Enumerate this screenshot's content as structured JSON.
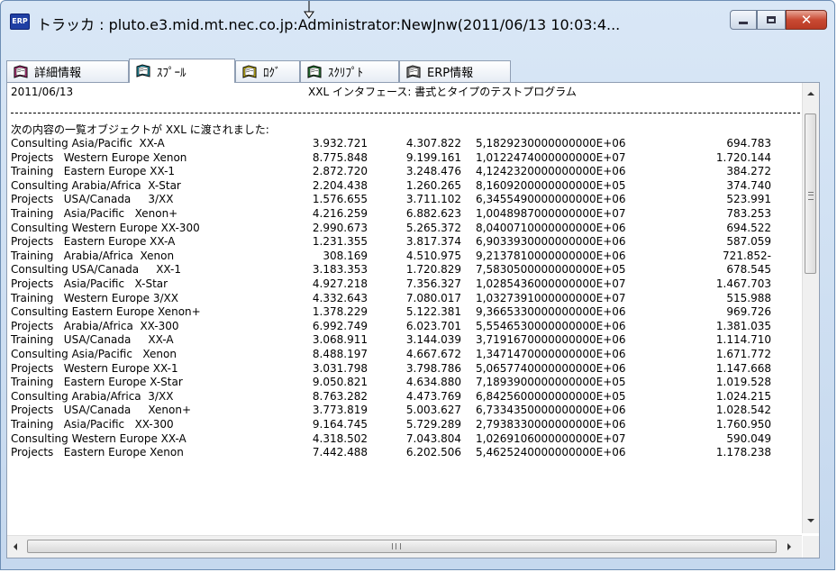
{
  "window": {
    "app_icon_label": "ERP",
    "title": "トラッカ : pluto.e3.mid.mt.nec.co.jp:Administrator:NewJnw(2011/06/13 10:03:4...",
    "colors": {
      "frame": "#c5d8ee",
      "close_button": "#c94a33",
      "tab_active": "#ffffff"
    }
  },
  "tabs": [
    {
      "label": "詳細情報",
      "icon": "book-icon",
      "active": false
    },
    {
      "label": "ｽﾌﾟｰﾙ",
      "icon": "book-icon",
      "active": true
    },
    {
      "label": "ﾛｸﾞ",
      "icon": "book-icon",
      "active": false
    },
    {
      "label": "ｽｸﾘﾌﾟﾄ",
      "icon": "book-icon",
      "active": false
    },
    {
      "label": "ERP情報",
      "icon": "book-icon",
      "active": false
    }
  ],
  "spool": {
    "date": "2011/06/13",
    "header": "XXL インタフェース: 書式とタイプのテストプログラム",
    "intro": "次の内容の一覧オブジェクトが XXL に渡されました:",
    "rows": [
      [
        "Consulting Asia/Pacific  XX-A",
        "3.932.721",
        "4.307.822",
        "5,1829230000000000E+06",
        "694.783"
      ],
      [
        "Projects   Western Europe Xenon",
        "8.775.848",
        "9.199.161",
        "1,0122474000000000E+07",
        "1.720.144"
      ],
      [
        "Training   Eastern Europe XX-1",
        "2.872.720",
        "3.248.476",
        "4,1242320000000000E+06",
        "384.272"
      ],
      [
        "Consulting Arabia/Africa  X-Star",
        "2.204.438",
        "1.260.265",
        "8,1609200000000000E+05",
        "374.740"
      ],
      [
        "Projects   USA/Canada     3/XX",
        "1.576.655",
        "3.711.102",
        "6,3455490000000000E+06",
        "523.991"
      ],
      [
        "Training   Asia/Pacific   Xenon+",
        "4.216.259",
        "6.882.623",
        "1,0048987000000000E+07",
        "783.253"
      ],
      [
        "Consulting Western Europe XX-300",
        "2.990.673",
        "5.265.372",
        "8,0400710000000000E+06",
        "694.522"
      ],
      [
        "Projects   Eastern Europe XX-A",
        "1.231.355",
        "3.817.374",
        "6,9033930000000000E+06",
        "587.059"
      ],
      [
        "Training   Arabia/Africa  Xenon",
        "308.169",
        "4.510.975",
        "9,2137810000000000E+06",
        "721.852-"
      ],
      [
        "Consulting USA/Canada     XX-1",
        "3.183.353",
        "1.720.829",
        "7,5830500000000000E+05",
        "678.545"
      ],
      [
        "Projects   Asia/Pacific   X-Star",
        "4.927.218",
        "7.356.327",
        "1,0285436000000000E+07",
        "1.467.703"
      ],
      [
        "Training   Western Europe 3/XX",
        "4.332.643",
        "7.080.017",
        "1,0327391000000000E+07",
        "515.988"
      ],
      [
        "Consulting Eastern Europe Xenon+",
        "1.378.229",
        "5.122.381",
        "9,3665330000000000E+06",
        "969.726"
      ],
      [
        "Projects   Arabia/Africa  XX-300",
        "6.992.749",
        "6.023.701",
        "5,5546530000000000E+06",
        "1.381.035"
      ],
      [
        "Training   USA/Canada     XX-A",
        "3.068.911",
        "3.144.039",
        "3,7191670000000000E+06",
        "1.114.710"
      ],
      [
        "Consulting Asia/Pacific   Xenon",
        "8.488.197",
        "4.667.672",
        "1,3471470000000000E+06",
        "1.671.772"
      ],
      [
        "Projects   Western Europe XX-1",
        "3.031.798",
        "3.798.786",
        "5,0657740000000000E+06",
        "1.147.668"
      ],
      [
        "Training   Eastern Europe X-Star",
        "9.050.821",
        "4.634.880",
        "7,1893900000000000E+05",
        "1.019.528"
      ],
      [
        "Consulting Arabia/Africa  3/XX",
        "8.763.282",
        "4.473.769",
        "6,8425600000000000E+05",
        "1.024.215"
      ],
      [
        "Projects   USA/Canada     Xenon+",
        "3.773.819",
        "5.003.627",
        "6,7334350000000000E+06",
        "1.028.542"
      ],
      [
        "Training   Asia/Pacific   XX-300",
        "9.164.745",
        "5.729.289",
        "2,7938330000000000E+06",
        "1.760.950"
      ],
      [
        "Consulting Western Europe XX-A",
        "4.318.502",
        "7.043.804",
        "1,0269106000000000E+07",
        "590.049"
      ],
      [
        "Projects   Eastern Europe Xenon",
        "7.442.488",
        "6.202.506",
        "5,4625240000000000E+06",
        "1.178.238"
      ]
    ]
  },
  "scrollbar": {
    "horizontal_grip": "III"
  }
}
